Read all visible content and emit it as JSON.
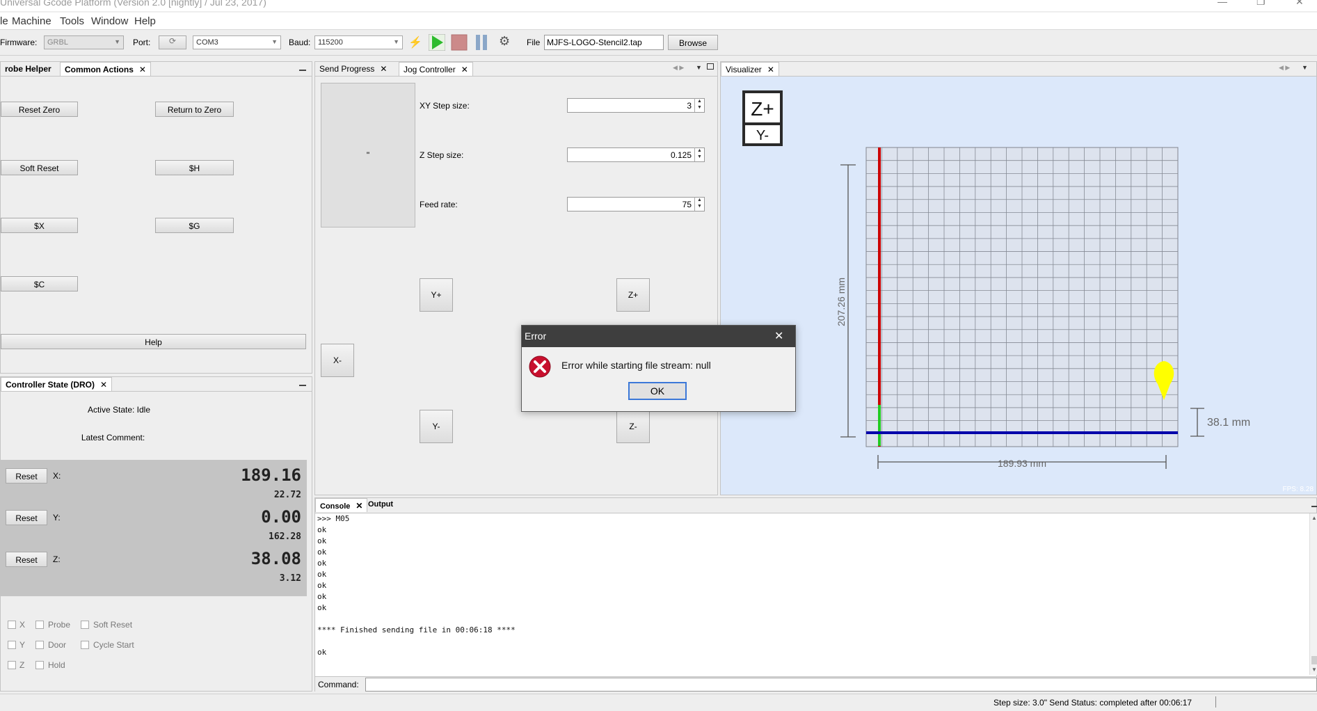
{
  "window": {
    "title": "Universal Gcode Platform (Version 2.0 [nightly] / Jul 23, 2017)",
    "minimize": "—",
    "maximize": "❐",
    "close": "✕"
  },
  "menu": [
    "le",
    "Machine",
    "Tools",
    "Window",
    "Help"
  ],
  "toolbar": {
    "firmware_label": "Firmware:",
    "firmware_value": "GRBL",
    "port_label": "Port:",
    "port_value": "COM3",
    "baud_label": "Baud:",
    "baud_value": "115200",
    "file_label": "File",
    "file_value": "MJFS-LOGO-Stencil2.tap",
    "browse_label": "Browse"
  },
  "common_actions": {
    "tabs": [
      "robe Helper",
      "Common Actions"
    ],
    "buttons": {
      "reset_zero": "Reset Zero",
      "return_to_zero": "Return to Zero",
      "soft_reset": "Soft Reset",
      "h": "$H",
      "x": "$X",
      "g": "$G",
      "c": "$C",
      "help": "Help"
    }
  },
  "dro": {
    "tab": "Controller State (DRO)",
    "active_state": "Active State: Idle",
    "latest_comment": "Latest Comment:",
    "reset_label": "Reset",
    "axes": [
      {
        "label": "X:",
        "machine": "189.16",
        "work": "22.72"
      },
      {
        "label": "Y:",
        "machine": "0.00",
        "work": "162.28"
      },
      {
        "label": "Z:",
        "machine": "38.08",
        "work": "3.12"
      }
    ],
    "pins": {
      "x": "X",
      "y": "Y",
      "z": "Z",
      "probe": "Probe",
      "door": "Door",
      "hold": "Hold",
      "soft_reset": "Soft Reset",
      "cycle_start": "Cycle Start"
    }
  },
  "jog": {
    "tabs": [
      "Send Progress",
      "Jog Controller"
    ],
    "pad_label": "\"",
    "xy_step_label": "XY Step size:",
    "xy_step_value": "3",
    "z_step_label": "Z Step size:",
    "z_step_value": "0.125",
    "feed_label": "Feed rate:",
    "feed_value": "75",
    "buttons": {
      "yplus": "Y+",
      "zplus": "Z+",
      "xminus": "X-",
      "yminus": "Y-",
      "zminus": "Z-"
    }
  },
  "visualizer": {
    "tab": "Visualizer",
    "cube_top": "Z+",
    "cube_front": "Y-",
    "height_dim": "207.26 mm",
    "width_dim": "189.93 mm",
    "z_dim": "38.1 mm",
    "fps": "FPS: 8.28",
    "bg_color": "#dce8fa"
  },
  "console": {
    "tabs": [
      "Console",
      "Output"
    ],
    "lines": [
      ">>> M05",
      "ok",
      "ok",
      "ok",
      "ok",
      "ok",
      "ok",
      "ok",
      "ok",
      "",
      "**** Finished sending file in 00:06:18 ****",
      "",
      "ok"
    ],
    "command_label": "Command:"
  },
  "dialog": {
    "title": "Error",
    "message": "Error while starting file stream: null",
    "ok": "OK"
  },
  "status_bar": {
    "text": "Step size: 3.0\" Send Status: completed after 00:06:17"
  }
}
